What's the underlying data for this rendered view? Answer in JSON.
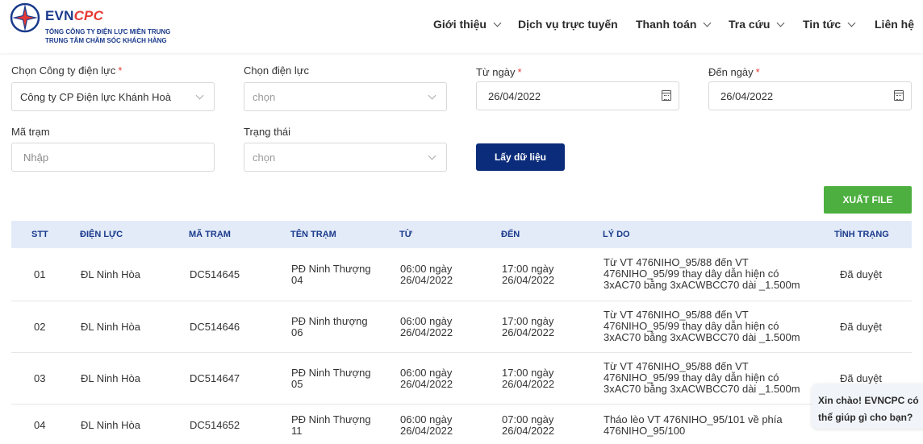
{
  "brand": {
    "name_part1": "EVN",
    "name_part2": "CPC",
    "subtitle1": "TỔNG CÔNG TY ĐIỆN LỰC MIỀN TRUNG",
    "subtitle2": "TRUNG TÂM CHĂM SÓC KHÁCH HÀNG"
  },
  "nav": [
    {
      "label": "Giới thiệu",
      "has_dropdown": true
    },
    {
      "label": "Dịch vụ trực tuyến",
      "has_dropdown": false
    },
    {
      "label": "Thanh toán",
      "has_dropdown": true
    },
    {
      "label": "Tra cứu",
      "has_dropdown": true
    },
    {
      "label": "Tin tức",
      "has_dropdown": true
    },
    {
      "label": "Liên hệ",
      "has_dropdown": false
    }
  ],
  "form": {
    "company": {
      "label": "Chọn Công ty điện lực",
      "required": "*",
      "value": "Công ty CP Điện lực Khánh Hoà"
    },
    "branch": {
      "label": "Chọn điện lực",
      "placeholder": "chọn"
    },
    "from_date": {
      "label": "Từ ngày",
      "required": "*",
      "value": "26/04/2022"
    },
    "to_date": {
      "label": "Đến ngày",
      "required": "*",
      "value": "26/04/2022"
    },
    "station": {
      "label": "Mã trạm",
      "placeholder": "Nhập"
    },
    "status": {
      "label": "Trạng thái",
      "placeholder": "chọn"
    },
    "get_button": "Lấy dữ liệu",
    "export_button": "XUẤT FILE"
  },
  "table": {
    "headers": [
      "STT",
      "ĐIỆN LỰC",
      "MÃ TRẠM",
      "TÊN TRẠM",
      "TỪ",
      "ĐẾN",
      "LÝ DO",
      "TÌNH TRẠNG"
    ],
    "rows": [
      {
        "stt": "01",
        "dien_luc": "ĐL Ninh Hòa",
        "ma_tram": "DC514645",
        "ten_tram": [
          "PĐ Ninh Thượng",
          "04"
        ],
        "tu": [
          "06:00 ngày",
          "26/04/2022"
        ],
        "den": [
          "17:00 ngày",
          "26/04/2022"
        ],
        "ly_do": [
          "Từ VT 476NIHO_95/88 đến VT",
          "476NIHO_95/99 thay dây dẫn hiện có",
          "3xAC70 bằng 3xACWBCC70 dài _1.500m"
        ],
        "tinh_trang": "Đã duyệt"
      },
      {
        "stt": "02",
        "dien_luc": "ĐL Ninh Hòa",
        "ma_tram": "DC514646",
        "ten_tram": [
          "PĐ Ninh thượng",
          "06"
        ],
        "tu": [
          "06:00 ngày",
          "26/04/2022"
        ],
        "den": [
          "17:00 ngày",
          "26/04/2022"
        ],
        "ly_do": [
          "Từ VT 476NIHO_95/88 đến VT",
          "476NIHO_95/99 thay dây dẫn hiện có",
          "3xAC70 bằng 3xACWBCC70 dài _1.500m"
        ],
        "tinh_trang": "Đã duyệt"
      },
      {
        "stt": "03",
        "dien_luc": "ĐL Ninh Hòa",
        "ma_tram": "DC514647",
        "ten_tram": [
          "PĐ Ninh Thượng",
          "05"
        ],
        "tu": [
          "06:00 ngày",
          "26/04/2022"
        ],
        "den": [
          "17:00 ngày",
          "26/04/2022"
        ],
        "ly_do": [
          "Từ VT 476NIHO_95/88 đến VT",
          "476NIHO_95/99 thay dây dẫn hiện có",
          "3xAC70 bằng 3xACWBCC70 dài _1.500m"
        ],
        "tinh_trang": "Đã duyệt"
      },
      {
        "stt": "04",
        "dien_luc": "ĐL Ninh Hòa",
        "ma_tram": "DC514652",
        "ten_tram": [
          "PĐ Ninh Thượng",
          "11"
        ],
        "tu": [
          "06:00 ngày",
          "26/04/2022"
        ],
        "den": [
          "07:00 ngày",
          "26/04/2022"
        ],
        "ly_do": [
          "Tháo lèo VT 476NIHO_95/101 về phía",
          "476NIHO_95/100"
        ],
        "tinh_trang": ""
      }
    ]
  },
  "chat": {
    "line1": "Xin chào! EVNCPC có",
    "line2": "thể giúp gì cho bạn?"
  },
  "colors": {
    "primary": "#0b2c7a",
    "export": "#4caf3f",
    "table_header_bg": "#e3ebf8",
    "required": "#e53935"
  }
}
